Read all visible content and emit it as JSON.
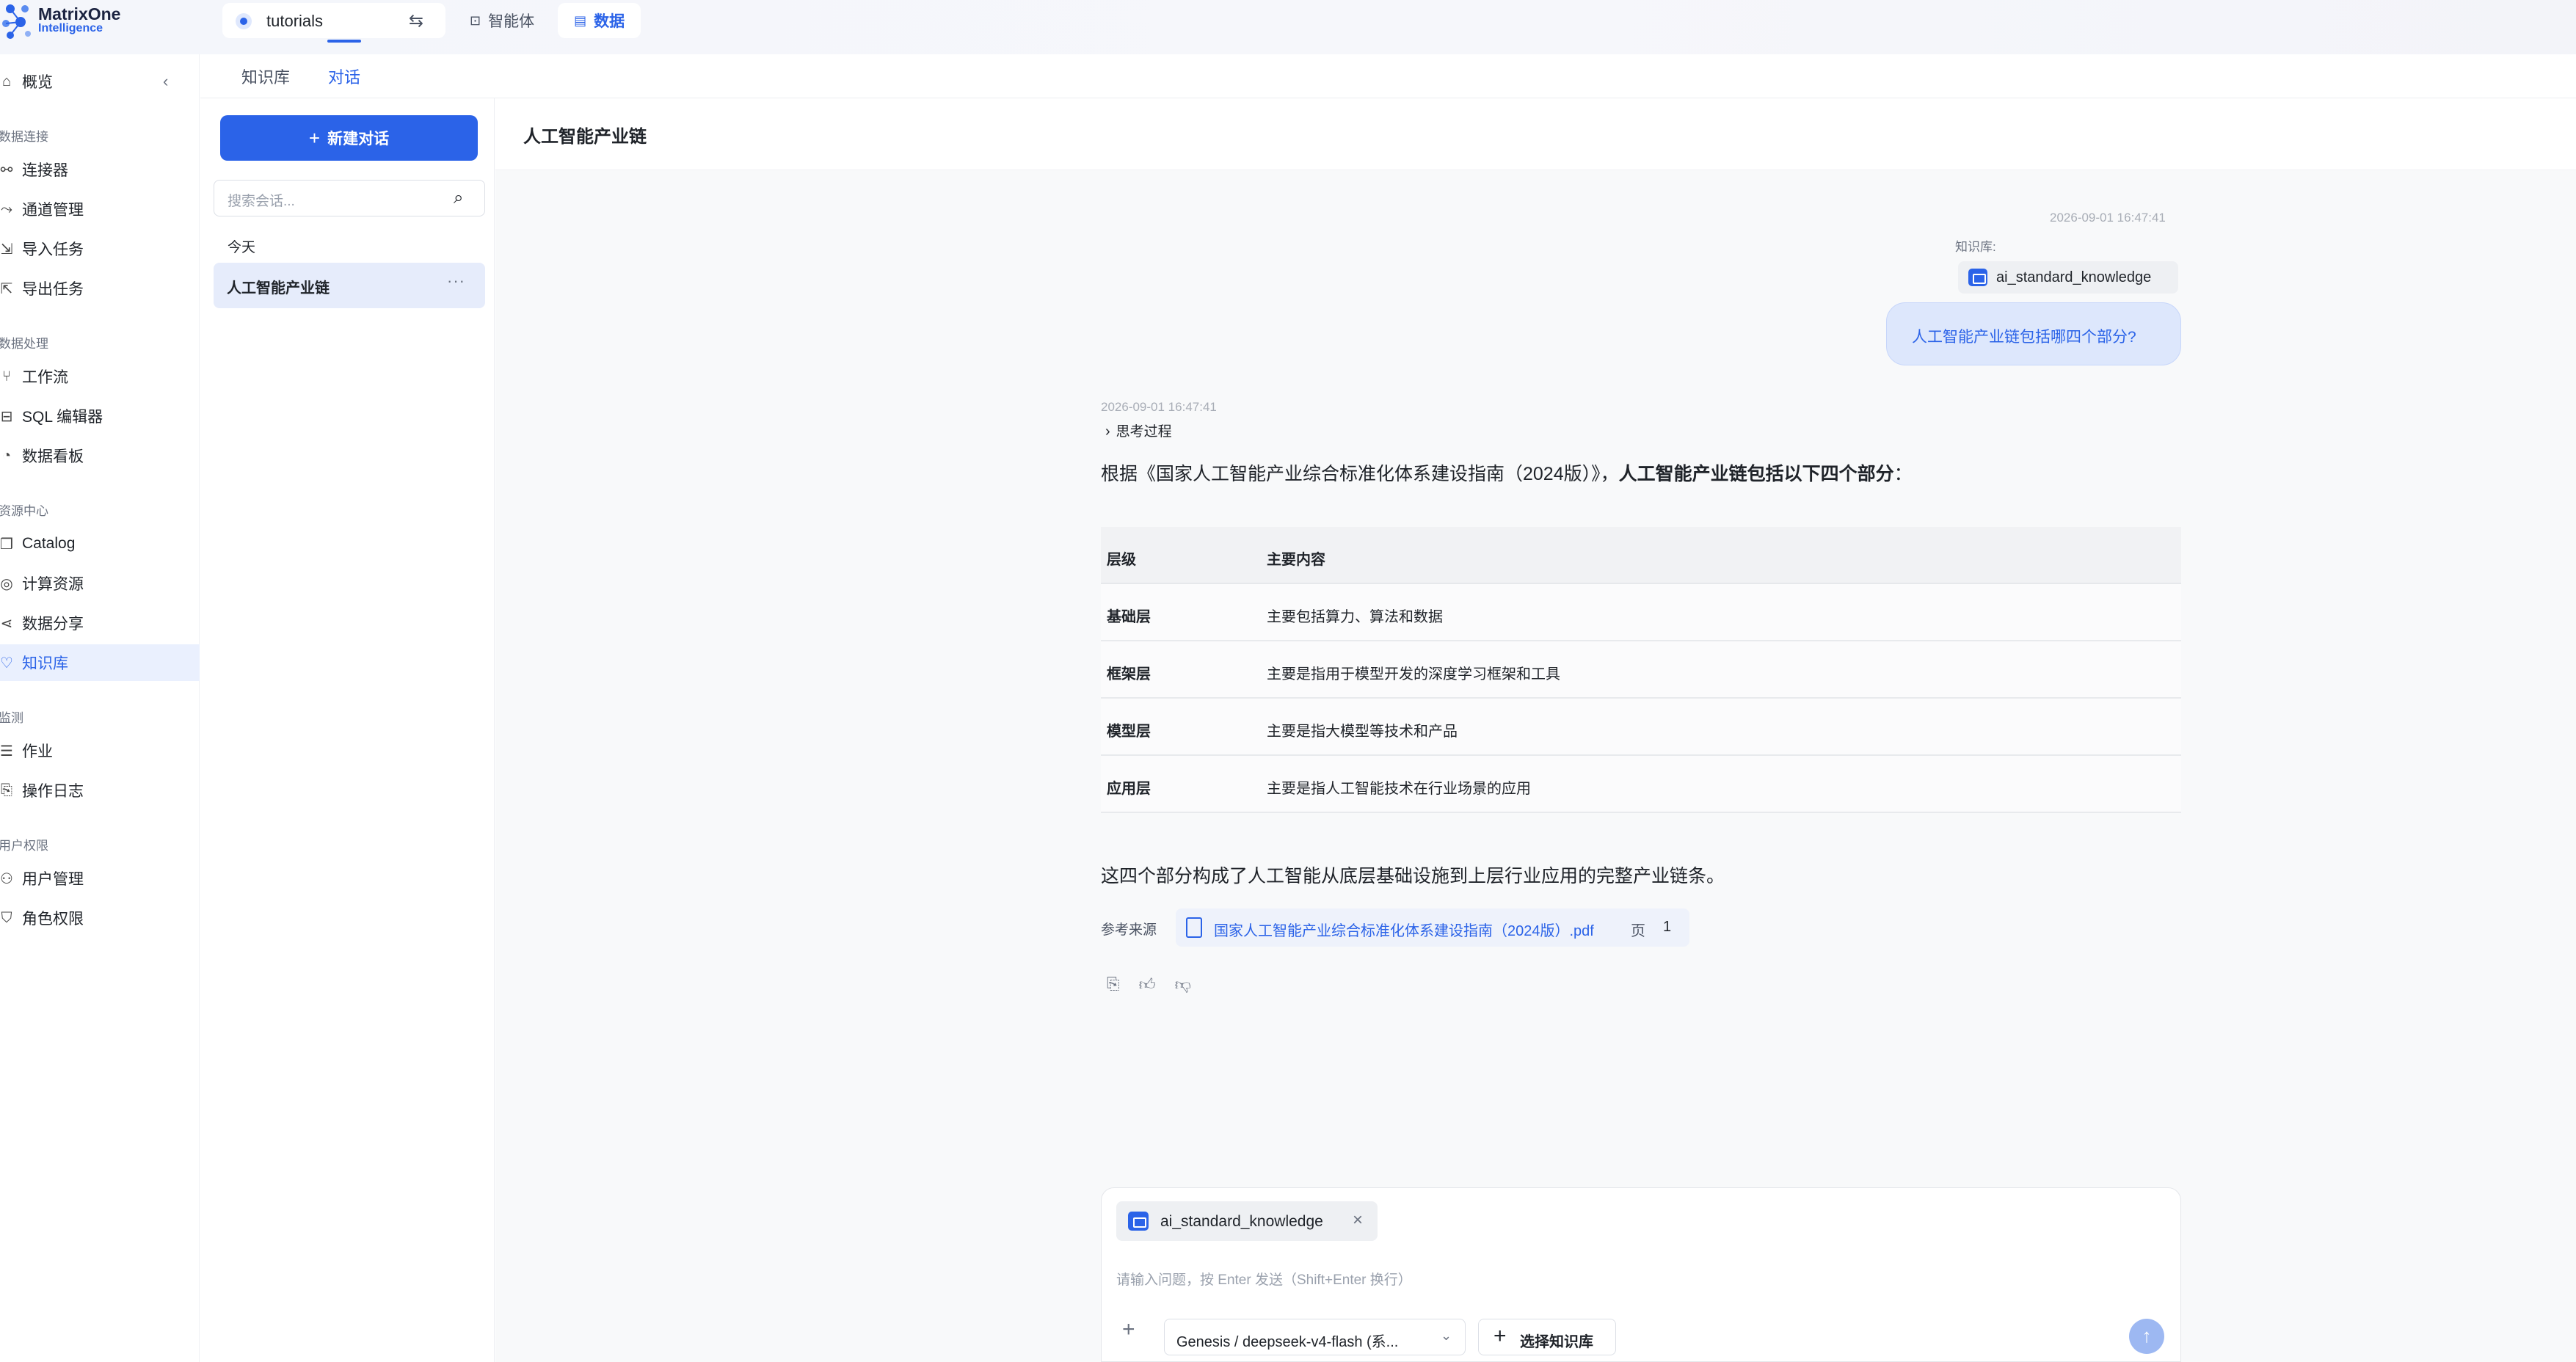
{
  "brand": {
    "line1": "MatrixOne",
    "line2": "Intelligence",
    "accent": "#2b63e8"
  },
  "workspace": {
    "name": "tutorials",
    "swap_icon": "swap-icon"
  },
  "nav_tabs": [
    {
      "label": "智能体",
      "icon": "agent-icon",
      "active": false
    },
    {
      "label": "数据",
      "icon": "data-icon",
      "active": true
    }
  ],
  "sidebar": {
    "overview": "概览",
    "groups": [
      {
        "title": "数据连接",
        "items": [
          "连接器",
          "通道管理",
          "导入任务",
          "导出任务"
        ]
      },
      {
        "title": "数据处理",
        "items": [
          "工作流",
          "SQL 编辑器",
          "数据看板"
        ]
      },
      {
        "title": "资源中心",
        "items": [
          "Catalog",
          "计算资源",
          "数据分享",
          "知识库"
        ]
      },
      {
        "title": "监测",
        "items": [
          "作业",
          "操作日志"
        ]
      },
      {
        "title": "用户权限",
        "items": [
          "用户管理",
          "角色权限"
        ]
      }
    ],
    "active_item": "知识库"
  },
  "subtabs": [
    "知识库",
    "对话"
  ],
  "conversations": {
    "new_button": "新建对话",
    "search_placeholder": "搜索会话...",
    "day": "今天",
    "items": [
      {
        "title": "人工智能产业链",
        "more": "···"
      }
    ]
  },
  "chat": {
    "title": "人工智能产业链",
    "user_timestamp": "2026-09-01 16:47:41",
    "kb_label": "知识库:",
    "kb_name": "ai_standard_knowledge",
    "question": "人工智能产业链包括哪四个部分?",
    "bot_timestamp": "2026-09-01 16:47:41",
    "thinking": "思考过程",
    "answer_prefix": "根据《国家人工智能产业综合标准化体系建设指南（2024版）》，",
    "answer_bold": "人工智能产业链包括以下四个部分",
    "answer_suffix": "：",
    "table": {
      "headers": [
        "层级",
        "主要内容"
      ],
      "rows": [
        [
          "基础层",
          "主要包括算力、算法和数据"
        ],
        [
          "框架层",
          "主要是指用于模型开发的深度学习框架和工具"
        ],
        [
          "模型层",
          "主要是指大模型等技术和产品"
        ],
        [
          "应用层",
          "主要是指人工智能技术在行业场景的应用"
        ]
      ]
    },
    "summary": "这四个部分构成了人工智能从底层基础设施到上层行业应用的完整产业链条。",
    "refs_label": "参考来源",
    "ref_doc": "国家人工智能产业综合标准化体系建设指南（2024版）.pdf",
    "ref_page_label": "页",
    "ref_page": "1"
  },
  "composer": {
    "kb_chip": "ai_standard_knowledge",
    "placeholder": "请输入问题，按 Enter 发送（Shift+Enter 换行）",
    "model": "Genesis / deepseek-v4-flash (系...",
    "kb_button": "选择知识库"
  }
}
